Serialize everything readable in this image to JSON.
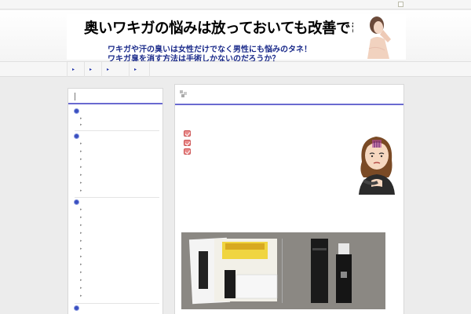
{
  "banner": {
    "title": "奥いワキガの悩みは放っておいても改善できない！",
    "subtitle_line1": "ワキガや汗の臭いは女性だけでなく男性にも悩みのタネ！",
    "subtitle_line2": "ワキガ臭を消す方法は手術しかないのだろうか？"
  },
  "nav": {
    "items": [
      "▸",
      "▸",
      "▸",
      "▸"
    ]
  },
  "sidebar": {
    "arrow": "▸"
  },
  "icons": {
    "rss": "feed-icon",
    "bullet": "circle-bullet-icon",
    "check": "checkbox-icon",
    "header_mark": "bookmark-icon"
  },
  "colors": {
    "accent_line": "#6a6ad0",
    "banner_text": "#1a2a8a",
    "bullet": "#3a4fc0",
    "check": "#e98a8a"
  }
}
